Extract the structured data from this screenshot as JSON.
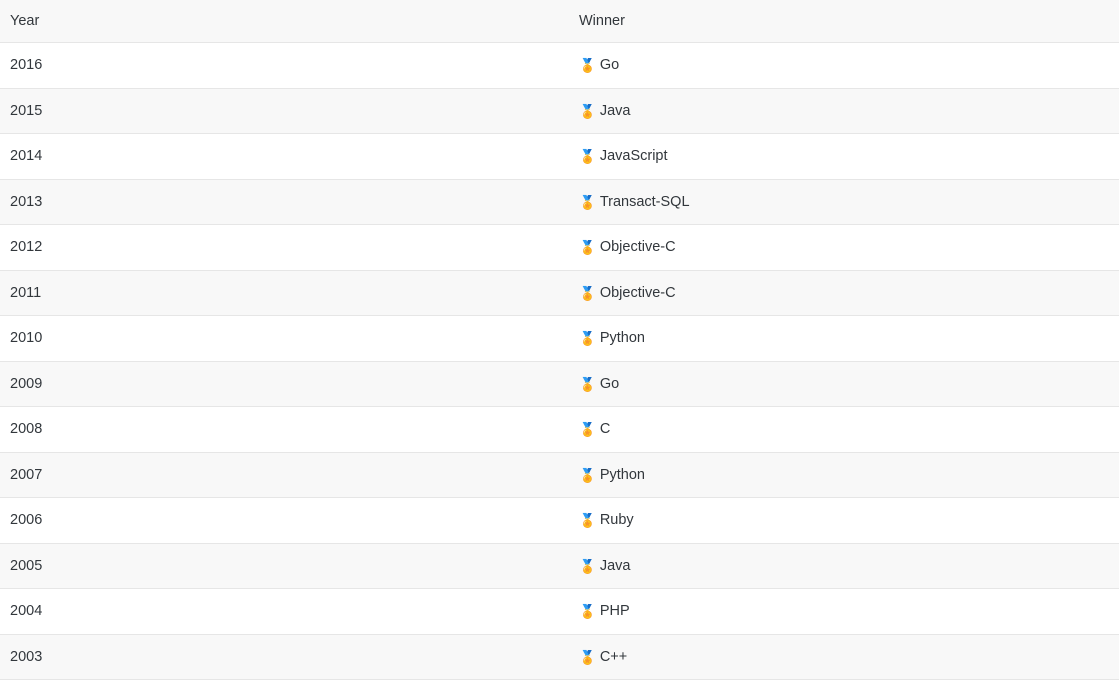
{
  "table": {
    "columns": [
      {
        "key": "year",
        "label": "Year"
      },
      {
        "key": "winner",
        "label": "Winner"
      }
    ],
    "medal_icon": "🏅",
    "icon_name": "medal-icon",
    "colors": {
      "text": "#32373c",
      "row_stripe": "#f8f8f8",
      "row_base": "#ffffff",
      "border": "#e6e6e6",
      "medal_ribbon": "#d8392b",
      "medal_star": "#f2c032"
    },
    "rows": [
      {
        "year": "2016",
        "winner": "Go"
      },
      {
        "year": "2015",
        "winner": "Java"
      },
      {
        "year": "2014",
        "winner": "JavaScript"
      },
      {
        "year": "2013",
        "winner": "Transact-SQL"
      },
      {
        "year": "2012",
        "winner": "Objective-C"
      },
      {
        "year": "2011",
        "winner": "Objective-C"
      },
      {
        "year": "2010",
        "winner": "Python"
      },
      {
        "year": "2009",
        "winner": "Go"
      },
      {
        "year": "2008",
        "winner": "C"
      },
      {
        "year": "2007",
        "winner": "Python"
      },
      {
        "year": "2006",
        "winner": "Ruby"
      },
      {
        "year": "2005",
        "winner": "Java"
      },
      {
        "year": "2004",
        "winner": "PHP"
      },
      {
        "year": "2003",
        "winner": "C++"
      }
    ]
  }
}
